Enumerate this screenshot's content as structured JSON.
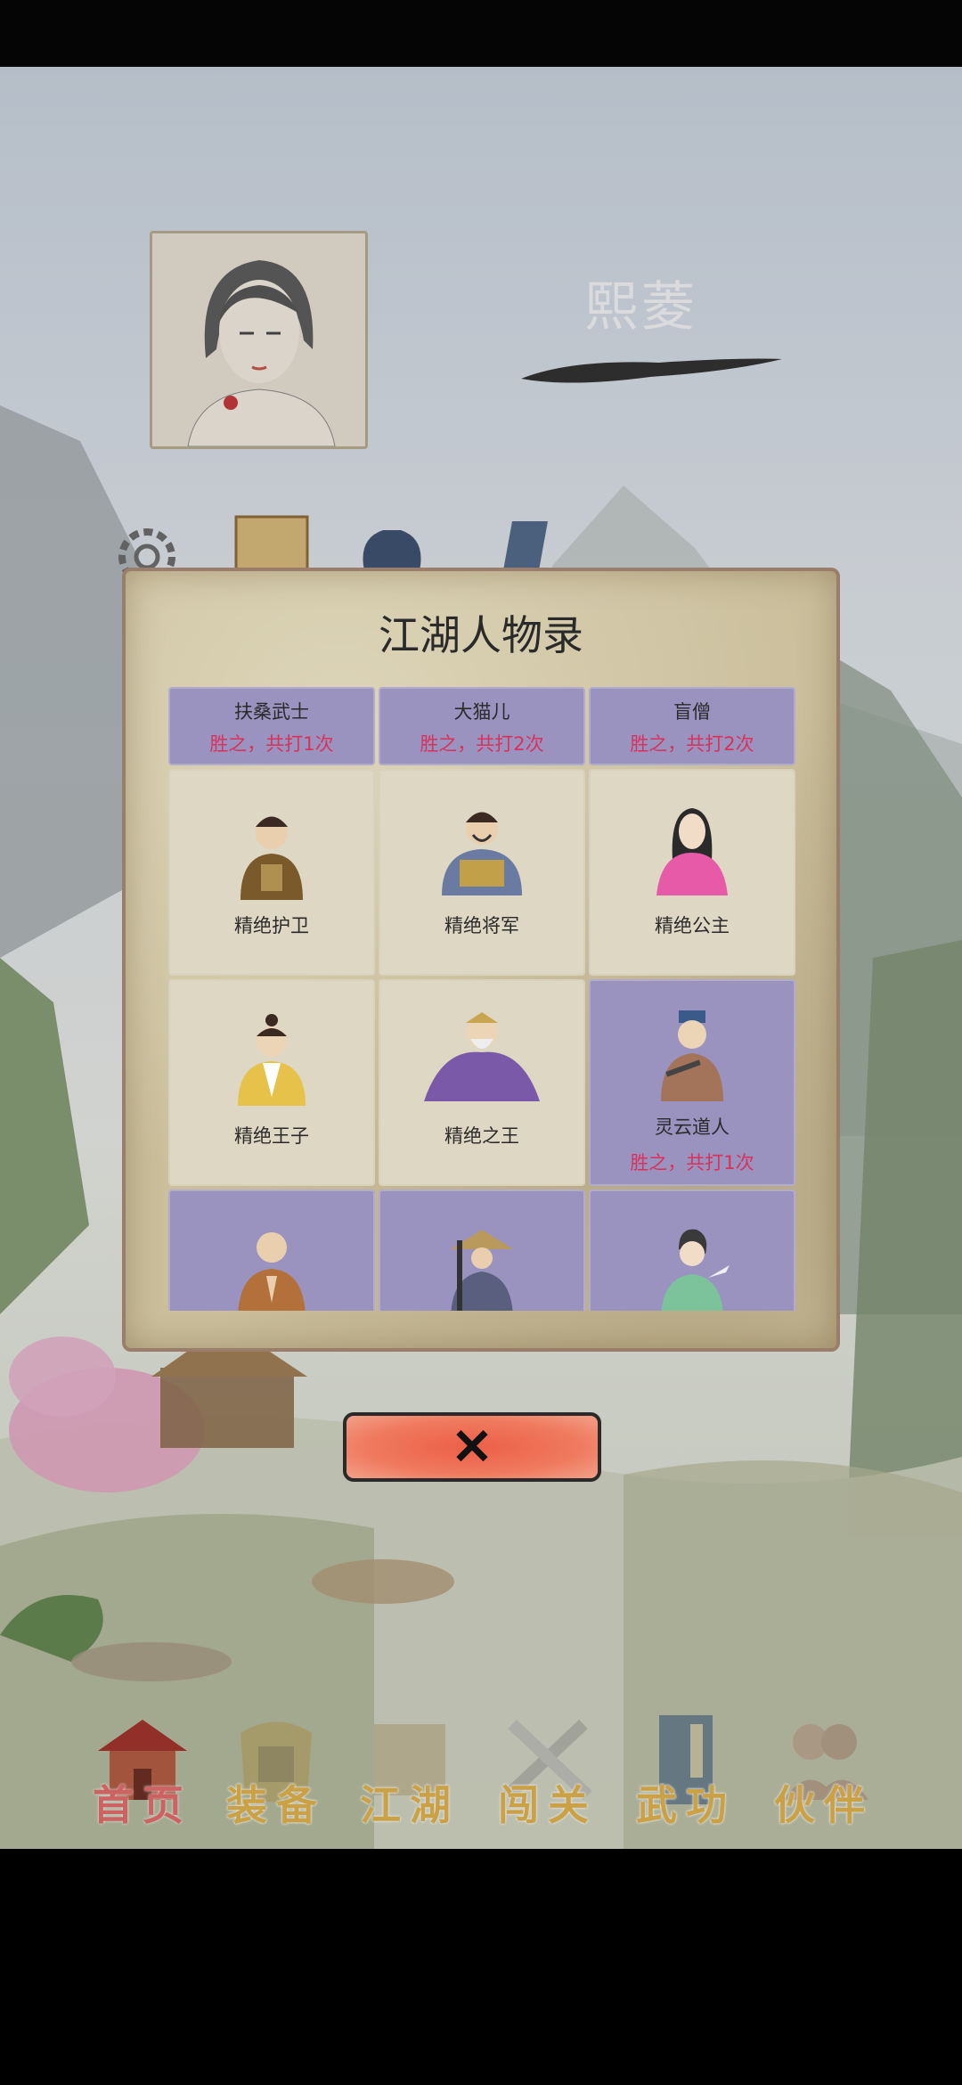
{
  "player": {
    "name": "熙菱"
  },
  "dialog": {
    "title": "江湖人物录",
    "rows": [
      [
        {
          "name": "扶桑武士",
          "record": "胜之，共打1次",
          "won": true
        },
        {
          "name": "大猫儿",
          "record": "胜之，共打2次",
          "won": true
        },
        {
          "name": "盲僧",
          "record": "胜之，共打2次",
          "won": true
        }
      ],
      [
        {
          "name": "精绝护卫",
          "record": "",
          "won": false,
          "portrait": "guard-portrait"
        },
        {
          "name": "精绝将军",
          "record": "",
          "won": false,
          "portrait": "general-portrait"
        },
        {
          "name": "精绝公主",
          "record": "",
          "won": false,
          "portrait": "princess-portrait"
        }
      ],
      [
        {
          "name": "精绝王子",
          "record": "",
          "won": false,
          "portrait": "prince-portrait"
        },
        {
          "name": "精绝之王",
          "record": "",
          "won": false,
          "portrait": "king-portrait"
        },
        {
          "name": "灵云道人",
          "record": "胜之，共打1次",
          "won": true,
          "portrait": "taoist-portrait"
        }
      ],
      [
        {
          "name": "",
          "record": "",
          "won": true,
          "portrait": "monk-portrait"
        },
        {
          "name": "",
          "record": "",
          "won": true,
          "portrait": "straw-hat-swordsman-portrait"
        },
        {
          "name": "",
          "record": "",
          "won": true,
          "portrait": "lady-portrait"
        }
      ]
    ],
    "close_symbol": "✕"
  },
  "nav": [
    {
      "label": "首页",
      "icon": "house-icon",
      "active": true
    },
    {
      "label": "装备",
      "icon": "armor-icon",
      "active": false
    },
    {
      "label": "江湖",
      "icon": "scroll-icon",
      "active": false
    },
    {
      "label": "闯关",
      "icon": "crossed-swords-icon",
      "active": false
    },
    {
      "label": "武功",
      "icon": "book-icon",
      "active": false
    },
    {
      "label": "伙伴",
      "icon": "partners-icon",
      "active": false
    }
  ],
  "colors": {
    "accent_red": "#d8315b",
    "won_cell": "#9a93c0",
    "nav_gold": "#e2b24a",
    "nav_active": "#e46a6a"
  }
}
